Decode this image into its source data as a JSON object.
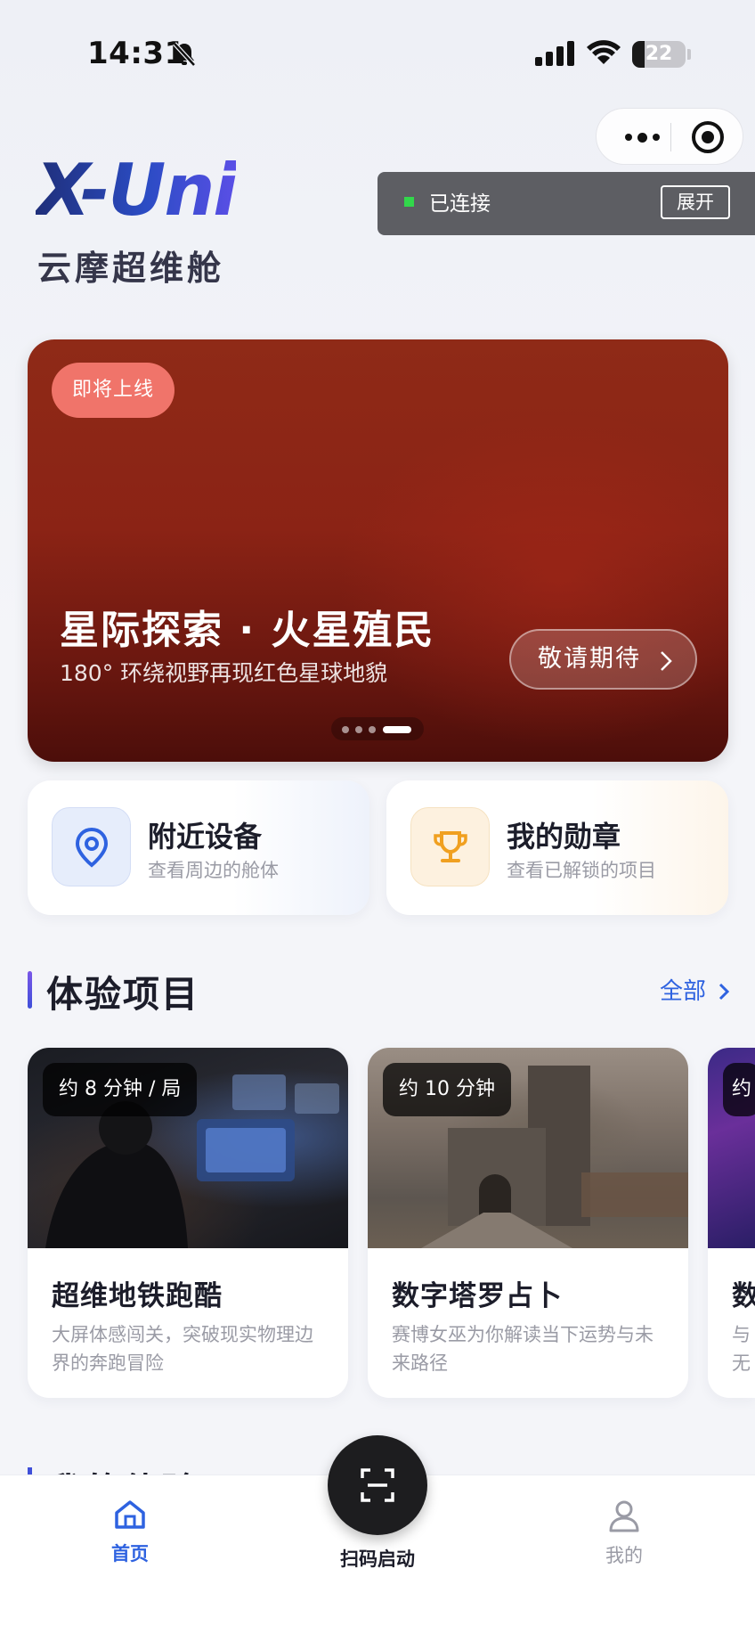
{
  "status_bar": {
    "time": "14:31",
    "battery": "22"
  },
  "connection": {
    "status": "已连接",
    "expand_label": "展开"
  },
  "brand": {
    "logo": "X-Uni",
    "subtitle": "云摩超维舱"
  },
  "banner": {
    "badge": "即将上线",
    "title": "星际探索 · 火星殖民",
    "description": "180° 环绕视野再现红色星球地貌",
    "cta": "敬请期待",
    "page_count": 4,
    "active_page": 4
  },
  "quick_entries": [
    {
      "title": "附近设备",
      "desc": "查看周边的舱体",
      "icon": "location-pin-icon",
      "color": "#2e62e0"
    },
    {
      "title": "我的勋章",
      "desc": "查看已解锁的项目",
      "icon": "trophy-icon",
      "color": "#f0a020"
    }
  ],
  "experience_section": {
    "title": "体验项目",
    "more": "全部"
  },
  "experiences": [
    {
      "tag": "约 8 分钟 / 局",
      "title": "超维地铁跑酷",
      "desc": "大屏体感闯关，突破现实物理边界的奔跑冒险"
    },
    {
      "tag": "约 10 分钟",
      "title": "数字塔罗占卜",
      "desc": "赛博女巫为你解读当下运势与未来路径"
    },
    {
      "tag": "约",
      "title": "数",
      "desc": "与无"
    }
  ],
  "my_section": {
    "title": "我的体验"
  },
  "tabbar": {
    "home": "首页",
    "scan": "扫码启动",
    "me": "我的"
  }
}
